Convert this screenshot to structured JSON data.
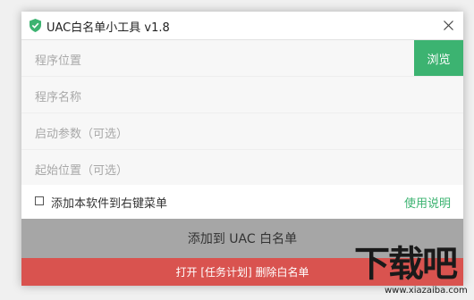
{
  "window": {
    "title": "UAC白名单小工具 v1.8"
  },
  "fields": {
    "program_path": {
      "placeholder": "程序位置"
    },
    "program_name": {
      "placeholder": "程序名称"
    },
    "launch_args": {
      "placeholder": "启动参数（可选）"
    },
    "start_dir": {
      "placeholder": "起始位置（可选）"
    }
  },
  "buttons": {
    "browse": "浏览",
    "add": "添加到 UAC 白名单",
    "task_scheduler": "打开 [任务计划] 删除白名单"
  },
  "options": {
    "context_menu_label": "添加本软件到右键菜单",
    "context_menu_checked": false,
    "help_link": "使用说明"
  },
  "watermark": {
    "main": "下载吧",
    "url": "www.xiazaiba.com"
  },
  "colors": {
    "accent_green": "#3cb371",
    "danger_red": "#d9534f",
    "add_button_gray": "#a6a6a6"
  },
  "icons": {
    "title_icon": "shield-check-icon",
    "close": "close-icon"
  }
}
